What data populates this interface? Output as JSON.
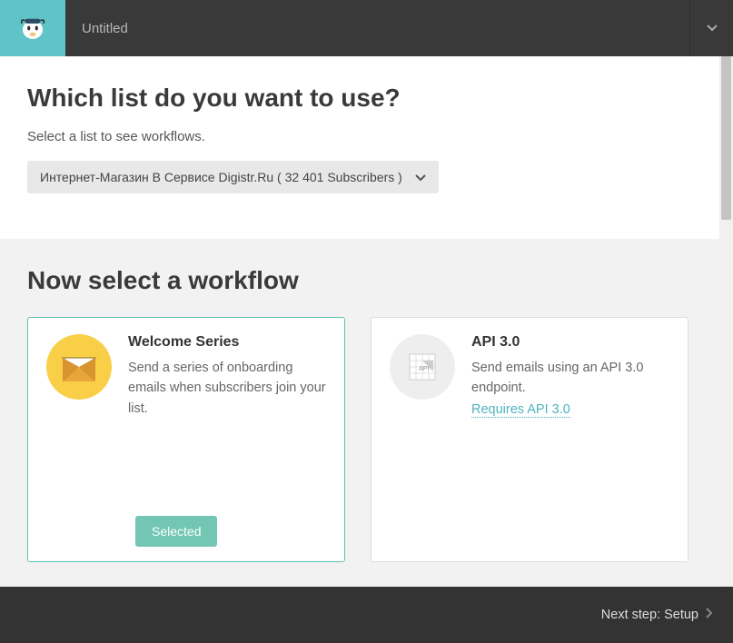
{
  "topbar": {
    "title": "Untitled"
  },
  "section1": {
    "heading": "Which list do you want to use?",
    "subtext": "Select a list to see workflows.",
    "dropdown_label": "Интернет-Магазин В Сервисе Digistr.Ru ( 32 401 Subscribers )"
  },
  "section2": {
    "heading": "Now select a workflow",
    "cards": [
      {
        "title": "Welcome Series",
        "desc": "Send a series of onboarding emails when subscribers join your list.",
        "selected_label": "Selected"
      },
      {
        "title": "API 3.0",
        "desc": "Send emails using an API 3.0 endpoint.",
        "link": "Requires API 3.0"
      }
    ]
  },
  "footer": {
    "next_label": "Next step: Setup"
  }
}
